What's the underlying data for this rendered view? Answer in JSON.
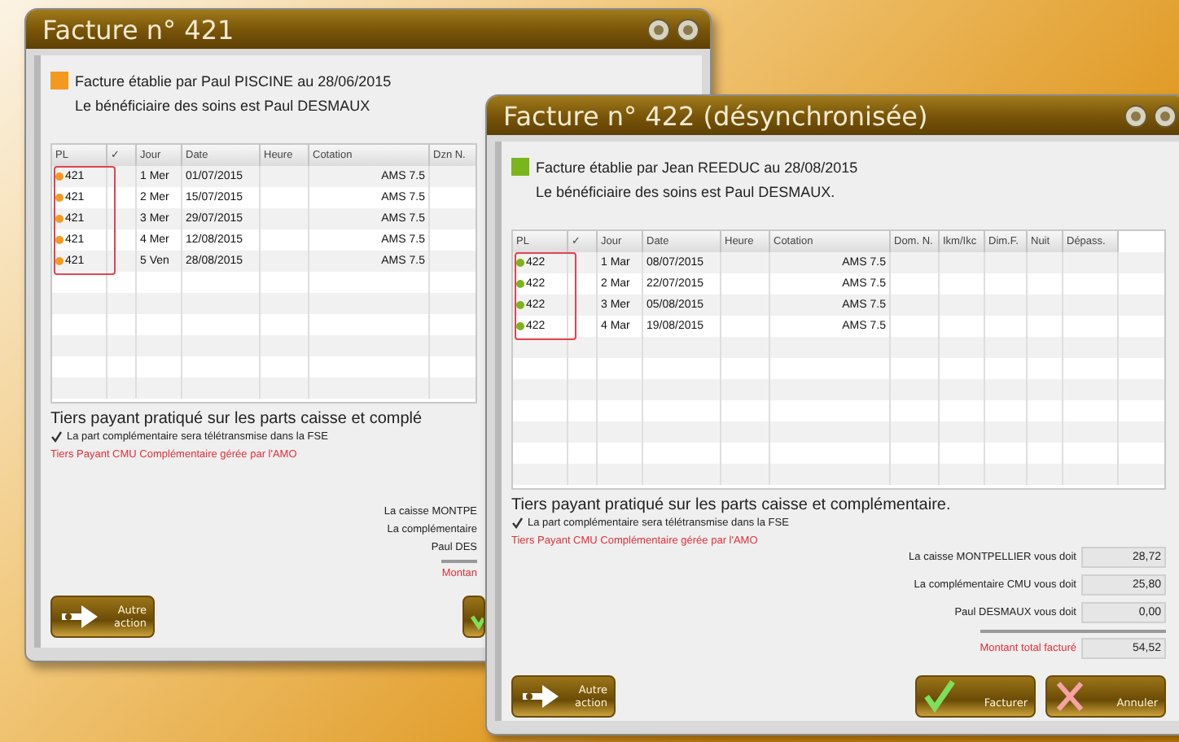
{
  "windows": [
    {
      "title": "Facture n° 421",
      "color": "#f39a1e",
      "issuer": "Facture établie par Paul PISCINE au 28/06/2015",
      "beneficiary": "Le bénéficiaire des soins est Paul DESMAUX",
      "columns": [
        "PL",
        "✓",
        "Jour",
        "Date",
        "Heure",
        "Cotation",
        "Dzn N."
      ],
      "rows": [
        {
          "pl": "421",
          "number": "1",
          "day": "Mer",
          "date": "01/07/2015",
          "code": "AMS 7.5"
        },
        {
          "pl": "421",
          "number": "2",
          "day": "Mer",
          "date": "15/07/2015",
          "code": "AMS 7.5"
        },
        {
          "pl": "421",
          "number": "3",
          "day": "Mer",
          "date": "29/07/2015",
          "code": "AMS 7.5"
        },
        {
          "pl": "421",
          "number": "4",
          "day": "Mer",
          "date": "12/08/2015",
          "code": "AMS 7.5"
        },
        {
          "pl": "421",
          "number": "5",
          "day": "Ven",
          "date": "28/08/2015",
          "code": "AMS 7.5"
        }
      ],
      "notice": "Tiers payant pratiqué sur les parts caisse et complé",
      "option": {
        "label": "La part complémentaire sera télétransmise dans la FSE",
        "checked": true
      },
      "warning": "Tiers Payant CMU Complémentaire gérée par l'AMO",
      "totals": [
        {
          "label": "La caisse MONTPE",
          "kind": "line"
        },
        {
          "label": "La complémentaire",
          "kind": "line"
        },
        {
          "label": "Paul DES",
          "kind": "line"
        },
        {
          "label": "Montan",
          "kind": "total"
        }
      ],
      "buttons": [
        {
          "kind": "other",
          "label": "Autre action"
        },
        {
          "kind": "confirm"
        }
      ]
    },
    {
      "title": "Facture n° 422 (désynchronisée)",
      "color": "#7ab51d",
      "issuer": "Facture établie par Jean REEDUC au 28/08/2015",
      "beneficiary": "Le bénéficiaire des soins est Paul DESMAUX.",
      "columns": [
        "PL",
        "✓",
        "Jour",
        "Date",
        "Heure",
        "Cotation",
        "Dom. N.",
        "Ikm/Ikc",
        "Dim.F.",
        "Nuit",
        "Dépass."
      ],
      "rows": [
        {
          "pl": "422",
          "number": "1",
          "day": "Mar",
          "date": "08/07/2015",
          "code": "AMS 7.5"
        },
        {
          "pl": "422",
          "number": "2",
          "day": "Mar",
          "date": "22/07/2015",
          "code": "AMS 7.5"
        },
        {
          "pl": "422",
          "number": "3",
          "day": "Mer",
          "date": "05/08/2015",
          "code": "AMS 7.5"
        },
        {
          "pl": "422",
          "number": "4",
          "day": "Mar",
          "date": "19/08/2015",
          "code": "AMS 7.5"
        }
      ],
      "notice": "Tiers payant pratiqué sur les parts caisse et complémentaire.",
      "option": {
        "label": "La part complémentaire sera télétransmise dans la FSE",
        "checked": true
      },
      "warning": "Tiers Payant CMU Complémentaire gérée par l'AMO",
      "totals": [
        {
          "label": "La caisse MONTPELLIER vous doit",
          "value": "28,72",
          "kind": "line"
        },
        {
          "label": "La complémentaire CMU vous doit",
          "value": "25,80",
          "kind": "line"
        },
        {
          "label": "Paul DESMAUX vous doit",
          "value": "0,00",
          "kind": "line"
        },
        {
          "label": "Montant total facturé",
          "value": "54,52",
          "kind": "total"
        }
      ],
      "buttons": [
        {
          "kind": "other",
          "label": "Autre action"
        },
        {
          "kind": "confirm",
          "label": "Facturer"
        },
        {
          "kind": "cancel",
          "label": "Annuler"
        }
      ]
    }
  ]
}
